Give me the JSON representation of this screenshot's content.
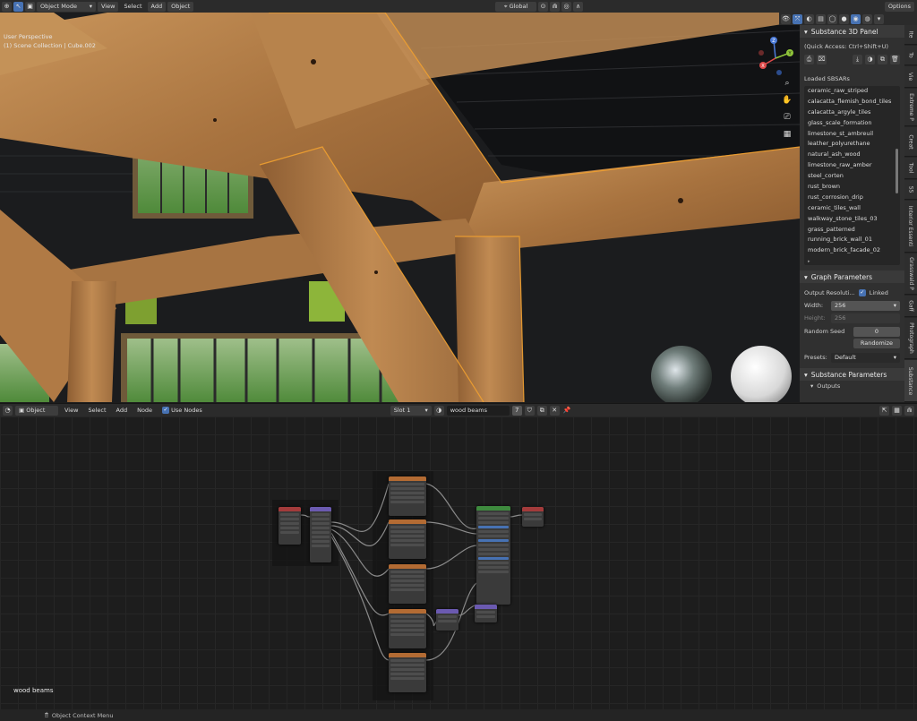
{
  "top_header": {
    "mode": "Object Mode",
    "menus": [
      "View",
      "Select",
      "Add",
      "Object"
    ],
    "transform_orientation": "Global",
    "options": "Options"
  },
  "viewport": {
    "view_name": "User Perspective",
    "collection": "(1) Scene Collection | Cube.002",
    "gizmo_axes": [
      "Z",
      "Y",
      "X"
    ]
  },
  "npanel": {
    "title": "Substance 3D Panel",
    "quick_access": "(Quick Access: Ctrl+Shift+U)",
    "loaded_label": "Loaded SBSARs",
    "sbsars": [
      "ceramic_raw_striped",
      "calacatta_flemish_bond_tiles",
      "calacatta_argyle_tiles",
      "glass_scale_formation",
      "limestone_st_ambreuil",
      "leather_polyurethane",
      "natural_ash_wood",
      "limestone_raw_amber",
      "steel_corten",
      "rust_brown",
      "rust_corrosion_drip",
      "ceramic_tiles_wall",
      "walkway_stone_tiles_03",
      "grass_patterned",
      "running_brick_wall_01",
      "modern_brick_facade_02"
    ],
    "graph_params_title": "Graph Parameters",
    "output_resolution_label": "Output Resoluti...",
    "linked_label": "Linked",
    "width_label": "Width:",
    "width_value": "256",
    "height_label": "Height:",
    "height_value": "256",
    "random_seed_label": "Random Seed",
    "random_seed_value": "0",
    "randomize_label": "Randomize",
    "presets_label": "Presets:",
    "presets_value": "Default",
    "substance_params_title": "Substance Parameters",
    "outputs_label": "Outputs"
  },
  "side_tabs": [
    "Ite",
    "To",
    "Vie",
    "Extreme P",
    "Creat",
    "Tool",
    "SS",
    "Interior Essenti",
    "Grasswald P",
    "Gaff",
    "Photograph",
    "Substance"
  ],
  "node_header": {
    "editor": "Object",
    "menus": [
      "View",
      "Select",
      "Add",
      "Node"
    ],
    "use_nodes": "Use Nodes",
    "slot": "Slot 1",
    "material": "wood beams",
    "users": "7"
  },
  "node_editor": {
    "material_label": "wood beams"
  },
  "status_bar": {
    "context_menu": "Object Context Menu"
  },
  "colors": {
    "accent_blue": "#4772b3",
    "wood_orange": "#b07a45",
    "selection_outline": "#f0a030"
  }
}
